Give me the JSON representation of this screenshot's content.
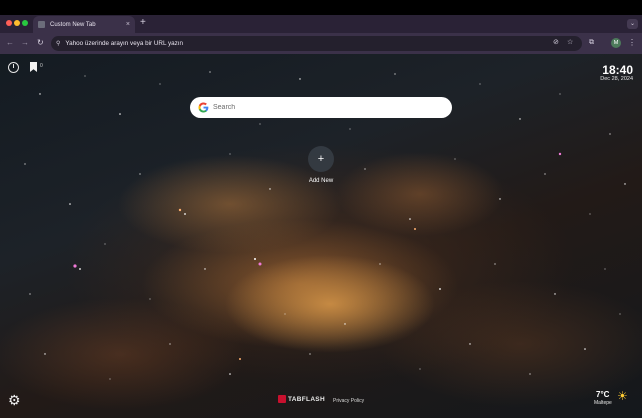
{
  "browser": {
    "tab": {
      "title": "Custom New Tab",
      "close_glyph": "×"
    },
    "new_tab_glyph": "+",
    "tab_search_glyph": "⌄",
    "address_bar": {
      "text": "Yahoo üzerinde arayın veya bir URL yazın"
    },
    "profile_initial": "M",
    "icons": [
      "back-arrow-icon",
      "forward-arrow-icon",
      "reload-icon",
      "site-settings-icon",
      "eye-off-icon",
      "star-icon",
      "extensions-icon",
      "menu-dots-icon"
    ]
  },
  "newtab": {
    "bookmark_count": "0",
    "clock": {
      "time": "18:40",
      "date": "Dec 28, 2024"
    },
    "search": {
      "placeholder": "Search"
    },
    "shortcut": {
      "glyph": "+",
      "label": "Add New"
    },
    "footer": {
      "brand": "TABFLASH",
      "privacy": "Privacy Policy"
    },
    "weather": {
      "temp": "7°C",
      "city": "Maltepe"
    }
  },
  "colors": {
    "tabstrip": "#2a2236",
    "toolbar": "#3b3149",
    "omnibox": "#24202d",
    "brand_red": "#c8102e",
    "sun": "#ffcc33"
  }
}
